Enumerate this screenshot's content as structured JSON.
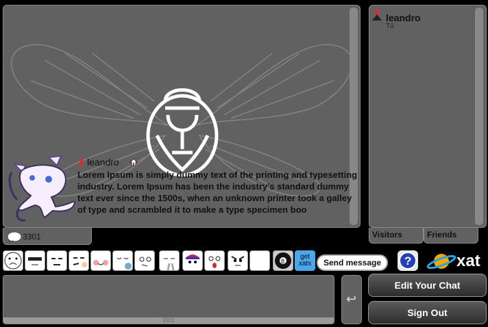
{
  "message": {
    "username": "leandro",
    "text": " Lorem Ipsum is simply dummy text of the printing and typesetting industry. Lorem Ipsum has been the industry’s standard dummy text ever since the 1500s, when an unknown printer took a galley of type and scrambled it to make a type specimen boo"
  },
  "chat_count": "3301",
  "input_count": "3301",
  "user_list": {
    "name": "leandro",
    "status": "Tú"
  },
  "tabs": {
    "visitors": "Visitors",
    "friends": "Friends"
  },
  "toolbar": {
    "get_xats": "get xats",
    "send_message": "Send message",
    "help_glyph": "?"
  },
  "logo": {
    "text": "xat"
  },
  "buttons": {
    "edit": "Edit Your Chat",
    "sign_out": "Sign Out",
    "enter_glyph": "↩"
  },
  "icons": [
    "cicada-background-icon",
    "mew-avatar-icon",
    "user-icon",
    "home-icon",
    "speech-bubble-icon",
    "help-icon",
    "xat-planet-icon"
  ],
  "colors": {
    "panel": "#616161",
    "background": "#000000",
    "accent_blue": "#4aa8e8",
    "planet": "#f2a900"
  }
}
